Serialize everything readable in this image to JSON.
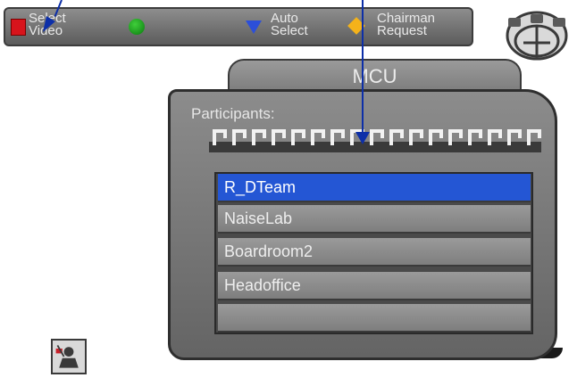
{
  "toolbar": {
    "select_video": "Select\nVideo",
    "auto_select": "Auto\nSelect",
    "chairman_request": "Chairman\nRequest",
    "colors": {
      "red": "#d8141c",
      "green": "#1ba51b",
      "blue": "#2c4fd9",
      "yellow": "#f4b21a"
    }
  },
  "mcu": {
    "tab_label": "MCU",
    "participants_label": "Participants:",
    "participants": [
      {
        "name": "R_DTeam",
        "selected": true
      },
      {
        "name": "NaiseLab",
        "selected": false
      },
      {
        "name": "Boardroom2",
        "selected": false
      },
      {
        "name": "Headoffice",
        "selected": false
      },
      {
        "name": "",
        "selected": false
      }
    ]
  },
  "icons": {
    "logo": "conference-logo-icon",
    "corner": "camera-operator-icon"
  }
}
